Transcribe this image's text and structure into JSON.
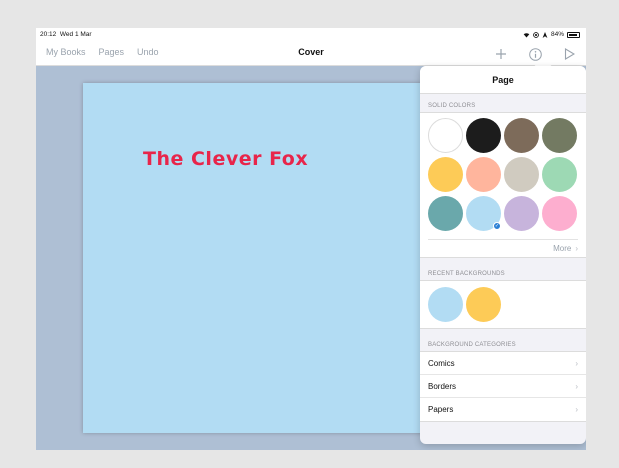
{
  "status": {
    "time": "20:12",
    "date": "Wed 1 Mar",
    "battery": "84%"
  },
  "nav": {
    "left": [
      "My Books",
      "Pages",
      "Undo"
    ],
    "title": "Cover",
    "icons": [
      "plus-icon",
      "info-icon",
      "play-icon"
    ]
  },
  "canvas": {
    "book_title": "The Clever Fox"
  },
  "popover": {
    "title": "Page",
    "solid_label": "SOLID COLORS",
    "colors": [
      "#ffffff",
      "#1c1c1c",
      "#7d6b5a",
      "#737a62",
      "#fdcb57",
      "#ffb59d",
      "#d0cbc0",
      "#9dd9b4",
      "#6aa8ab",
      "#b2dcf3",
      "#c7b4dc",
      "#fdaecf"
    ],
    "selected_color": "#b2dcf3",
    "more_label": "More",
    "recent_label": "RECENT BACKGROUNDS",
    "recent": [
      "#b2dcf3",
      "#fdcb57"
    ],
    "categories_label": "BACKGROUND CATEGORIES",
    "categories": [
      "Comics",
      "Borders",
      "Papers"
    ]
  }
}
